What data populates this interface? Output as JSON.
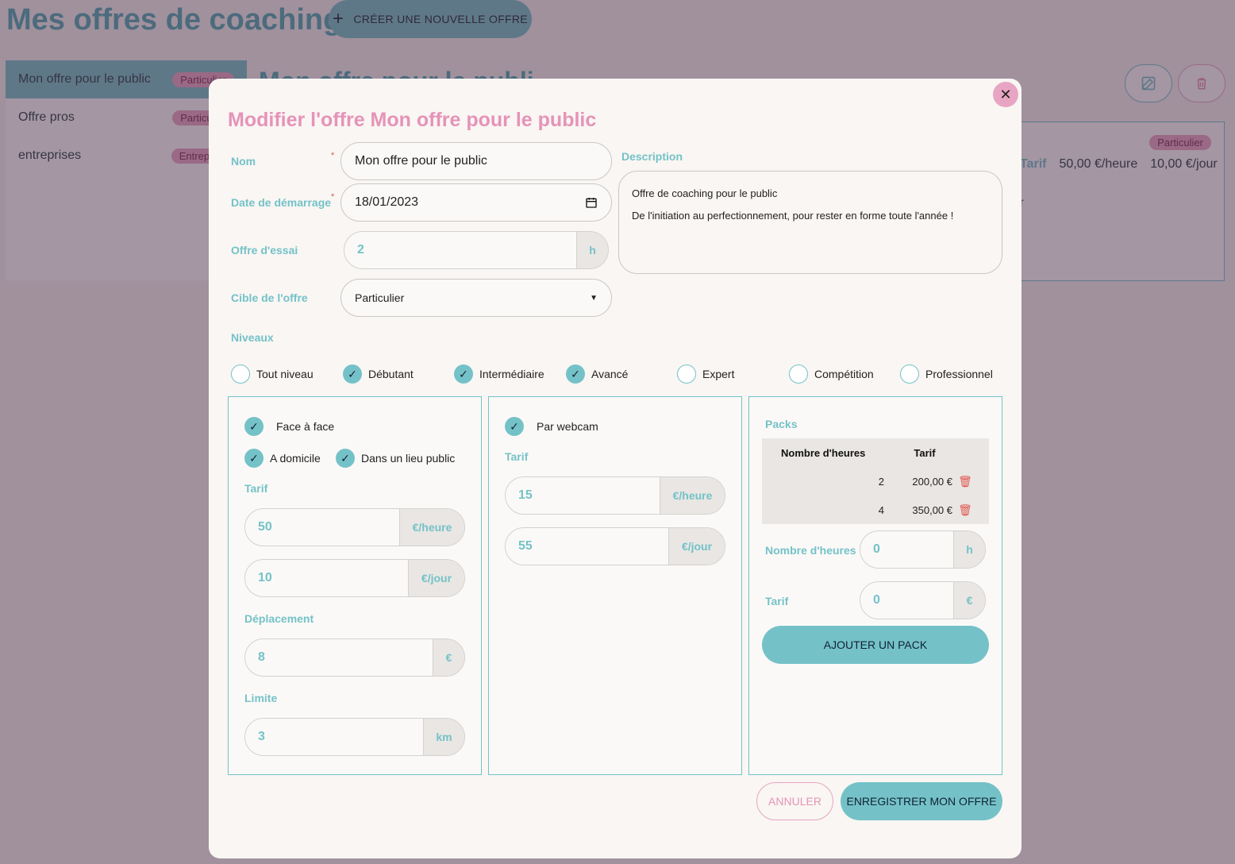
{
  "page": {
    "title": "Mes offres de coaching",
    "create_button": "CRÉER UNE NOUVELLE OFFRE",
    "heading_partial": "Mon offre pour le publi",
    "offers": [
      {
        "name": "Mon offre pour le public",
        "tag": "Particulier"
      },
      {
        "name": "Offre pros",
        "tag": "Particulier"
      },
      {
        "name": "entreprises",
        "tag": "Entreprise"
      }
    ],
    "card": {
      "tag": "Particulier",
      "tarif_label": "Tarif",
      "hour_rate": "50,00 €/heure",
      "day_rate": "10,00 €/jour",
      "fragment": "r"
    }
  },
  "modal": {
    "title": "Modifier l'offre Mon offre pour le public",
    "name_label": "Nom",
    "name_value": "Mon offre pour le public",
    "date_label": "Date de démarrage",
    "date_value": "18/01/2023",
    "trial_label": "Offre d'essai",
    "trial_value": "2",
    "trial_unit": "h",
    "target_label": "Cible de l'offre",
    "target_value": "Particulier",
    "required_mark": "*",
    "description_label": "Description",
    "description_lines": [
      "Offre de coaching pour le public",
      "De l'initiation au perfectionnement, pour rester en forme toute l'année !"
    ],
    "levels_label": "Niveaux",
    "levels": [
      {
        "label": "Tout niveau",
        "checked": false
      },
      {
        "label": "Débutant",
        "checked": true
      },
      {
        "label": "Intermédiaire",
        "checked": true
      },
      {
        "label": "Avancé",
        "checked": true
      },
      {
        "label": "Expert",
        "checked": false
      },
      {
        "label": "Compétition",
        "checked": false
      },
      {
        "label": "Professionnel",
        "checked": false
      }
    ],
    "face": {
      "label": "Face à face",
      "home": "A domicile",
      "public": "Dans un lieu public",
      "tarif_label": "Tarif",
      "hour_value": "50",
      "hour_unit": "€/heure",
      "day_value": "10",
      "day_unit": "€/jour",
      "travel_label": "Déplacement",
      "travel_value": "8",
      "travel_unit": "€",
      "limit_label": "Limite",
      "limit_value": "3",
      "limit_unit": "km"
    },
    "webcam": {
      "label": "Par webcam",
      "tarif_label": "Tarif",
      "hour_value": "15",
      "hour_unit": "€/heure",
      "day_value": "55",
      "day_unit": "€/jour"
    },
    "packs": {
      "label": "Packs",
      "col_hours": "Nombre d'heures",
      "col_price": "Tarif",
      "rows": [
        {
          "hours": "2",
          "price": "200,00 €"
        },
        {
          "hours": "4",
          "price": "350,00 €"
        }
      ],
      "hours_label": "Nombre d'heures",
      "hours_value": "0",
      "hours_unit": "h",
      "price_label": "Tarif",
      "price_value": "0",
      "price_unit": "€",
      "add_button": "AJOUTER UN PACK"
    },
    "cancel_button": "ANNULER",
    "save_button": "ENREGISTRER MON OFFRE",
    "close_icon": "close-icon"
  },
  "colors": {
    "accent": "#74c2c8",
    "pink": "#e693b8",
    "overlay": "#4a2e48"
  }
}
